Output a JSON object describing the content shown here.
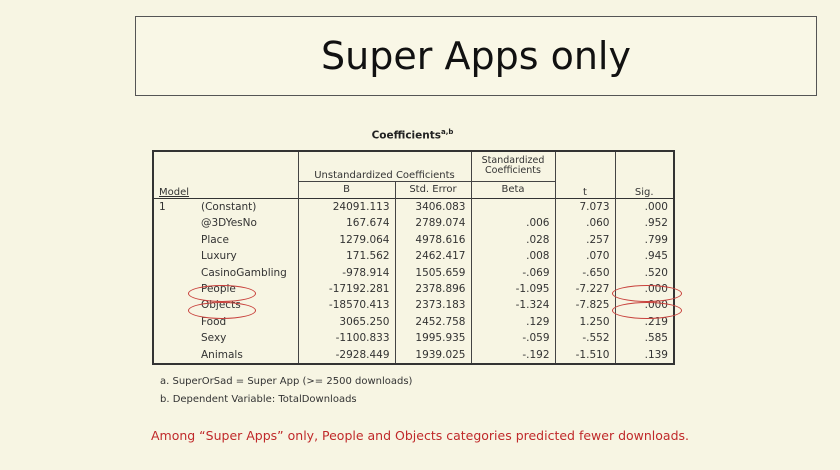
{
  "title": "Super Apps only",
  "table": {
    "caption": "Coefficients",
    "caption_sup": "a,b",
    "headers": {
      "model": "Model",
      "unstd": "Unstandardized Coefficients",
      "std": "Standardized Coefficients",
      "b": "B",
      "se": "Std. Error",
      "beta": "Beta",
      "t": "t",
      "sig": "Sig."
    },
    "model_number": "1",
    "rows": [
      {
        "var": "(Constant)",
        "b": "24091.113",
        "se": "3406.083",
        "beta": "",
        "t": "7.073",
        "sig": ".000"
      },
      {
        "var": "@3DYesNo",
        "b": "167.674",
        "se": "2789.074",
        "beta": ".006",
        "t": ".060",
        "sig": ".952"
      },
      {
        "var": "Place",
        "b": "1279.064",
        "se": "4978.616",
        "beta": ".028",
        "t": ".257",
        "sig": ".799"
      },
      {
        "var": "Luxury",
        "b": "171.562",
        "se": "2462.417",
        "beta": ".008",
        "t": ".070",
        "sig": ".945"
      },
      {
        "var": "CasinoGambling",
        "b": "-978.914",
        "se": "1505.659",
        "beta": "-.069",
        "t": "-.650",
        "sig": ".520"
      },
      {
        "var": "People",
        "b": "-17192.281",
        "se": "2378.896",
        "beta": "-1.095",
        "t": "-7.227",
        "sig": ".000"
      },
      {
        "var": "Objects",
        "b": "-18570.413",
        "se": "2373.183",
        "beta": "-1.324",
        "t": "-7.825",
        "sig": ".000"
      },
      {
        "var": "Food",
        "b": "3065.250",
        "se": "2452.758",
        "beta": ".129",
        "t": "1.250",
        "sig": ".219"
      },
      {
        "var": "Sexy",
        "b": "-1100.833",
        "se": "1995.935",
        "beta": "-.059",
        "t": "-.552",
        "sig": ".585"
      },
      {
        "var": "Animals",
        "b": "-2928.449",
        "se": "1939.025",
        "beta": "-.192",
        "t": "-1.510",
        "sig": ".139"
      }
    ],
    "footnotes": [
      "a. SuperOrSad = Super App (>= 2500 downloads)",
      "b. Dependent Variable: TotalDownloads"
    ]
  },
  "conclusion": "Among “Super Apps” only, People and Objects categories predicted fewer downloads.",
  "colors": {
    "highlight": "#c8413c",
    "conclusion": "#c0292a"
  }
}
